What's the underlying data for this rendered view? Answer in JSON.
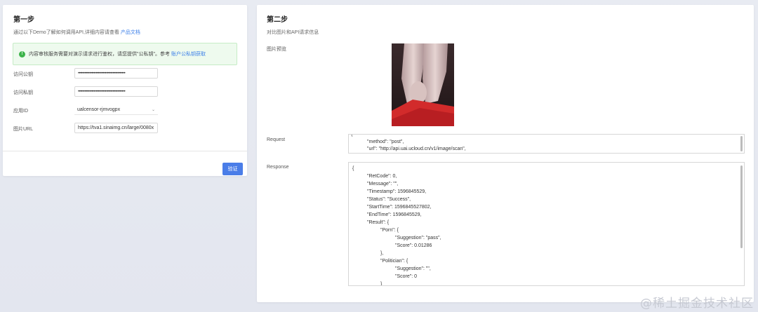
{
  "left": {
    "title": "第一步",
    "desc": "通过以下Demo了解如何调用API,详细内容请查看",
    "desc_link": "产品文档",
    "alert_text": "内容审核服务需要对演示请求进行鉴权，请您提供\"公私钥\"。参考",
    "alert_link": "账户公私钥获取",
    "fields": [
      {
        "label": "访问公钥",
        "value": "••••••••••••••••••••••••••••••••••••••••••"
      },
      {
        "label": "访问私钥",
        "value": "••••••••••••••••••••••••••••••••••••••••••"
      },
      {
        "label": "应用ID",
        "value": "ualcensor-rjmvogpx"
      },
      {
        "label": "图片URL",
        "value": "https://tva1.sinaimg.cn/large/0080x"
      }
    ],
    "verify_label": "验证"
  },
  "right": {
    "title": "第二步",
    "desc": "对比图片和API请求信息",
    "preview_label": "图片预览",
    "request_label": "Request",
    "response_label": "Response",
    "request_lines": [
      "{",
      "\"method\": \"post\",",
      "\"url\": \"http://api.uai.ucloud.cn/v1/image/scan\","
    ],
    "response_lines": [
      "{",
      "\"RetCode\": 0,",
      "\"Message\": \"\",",
      "\"Timestamp\": 1596845529,",
      "\"Status\": \"Success\",",
      "\"StartTime\": 1596845527802,",
      "\"EndTime\": 1596845529,",
      "\"Result\": {",
      "\"Porn\": {",
      "\"Suggestion\": \"pass\",",
      "\"Score\": 0.01286",
      "},",
      "\"Politician\": {",
      "\"Suggestion\": \"\",",
      "\"Score\": 0",
      "}"
    ]
  },
  "watermark": "@稀土掘金技术社区",
  "colors": {
    "accent": "#4a7de8",
    "link": "#3a7ee8",
    "success": "#3cb34a"
  }
}
